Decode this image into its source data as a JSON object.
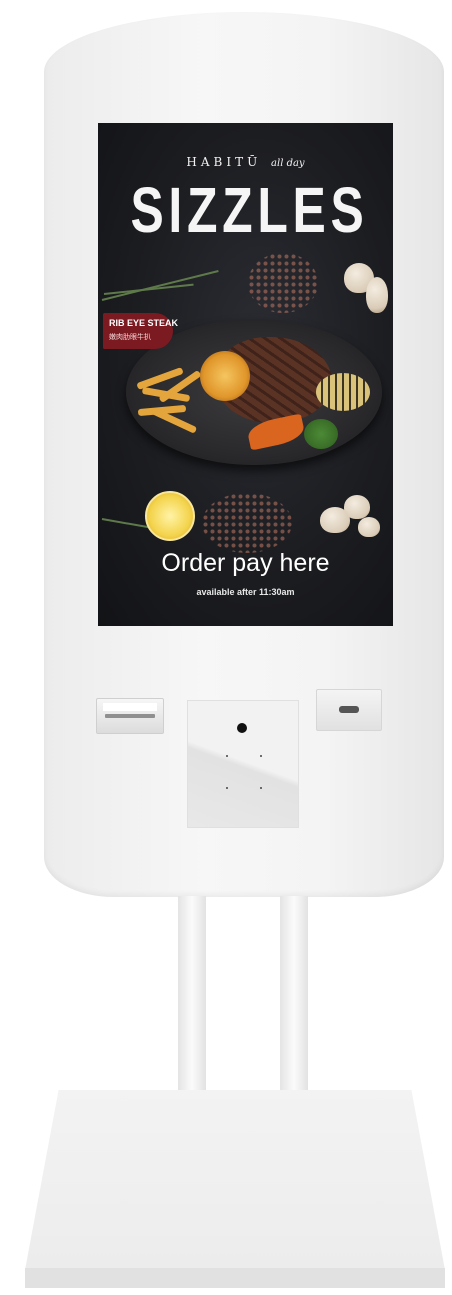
{
  "screen": {
    "brand_name": "HABITŪ",
    "brand_tagline": "all day",
    "headline": "SIZZLES",
    "badge_title": "RIB EYE STEAK",
    "badge_subtitle": "嫩肉肋眼牛扒",
    "call_to_action": "Order pay here",
    "availability": "available after 11:30am"
  },
  "colors": {
    "screen_background": "#1c1d21",
    "badge": "#7c1a22",
    "kiosk_body": "#f4f4f4"
  }
}
